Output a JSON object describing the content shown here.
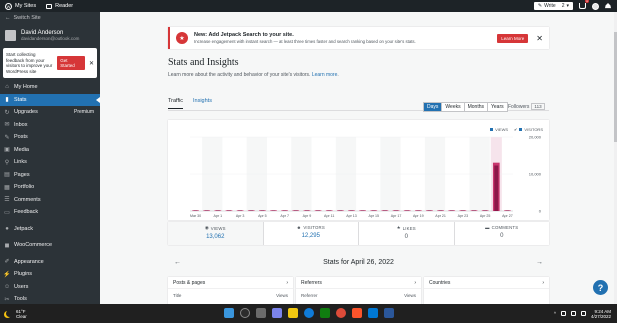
{
  "topbar": {
    "my_sites": "My Sites",
    "reader": "Reader",
    "write": "Write",
    "write_count": "2",
    "cart_badge": "1"
  },
  "sidebar": {
    "switch_site": "Switch Site",
    "site_name": "David Anderson",
    "site_url": "davidanderson@outlook.com",
    "feedback": {
      "text": "Start collecting feedback from your visitors to improve your WordPress site",
      "button": "Get Started"
    },
    "items": [
      {
        "label": "My Home",
        "icon": "home-icon",
        "glyph": "⌂"
      },
      {
        "label": "Stats",
        "icon": "stats-icon",
        "glyph": "▮",
        "active": true
      },
      {
        "label": "Upgrades",
        "icon": "upgrades-icon",
        "glyph": "↻",
        "right": "Premium"
      },
      {
        "label": "Inbox",
        "icon": "inbox-icon",
        "glyph": "✉"
      },
      {
        "label": "Posts",
        "icon": "posts-icon",
        "glyph": "✎"
      },
      {
        "label": "Media",
        "icon": "media-icon",
        "glyph": "▣"
      },
      {
        "label": "Links",
        "icon": "links-icon",
        "glyph": "⚲"
      },
      {
        "label": "Pages",
        "icon": "pages-icon",
        "glyph": "▤"
      },
      {
        "label": "Portfolio",
        "icon": "portfolio-icon",
        "glyph": "▦"
      },
      {
        "label": "Comments",
        "icon": "comments-icon",
        "glyph": "☰"
      },
      {
        "label": "Feedback",
        "icon": "feedback-icon",
        "glyph": "▭"
      },
      {
        "label": "Jetpack",
        "icon": "jetpack-icon",
        "glyph": "●"
      },
      {
        "label": "WooCommerce",
        "icon": "woocommerce-icon",
        "glyph": "◼"
      },
      {
        "label": "Appearance",
        "icon": "appearance-icon",
        "glyph": "✐"
      },
      {
        "label": "Plugins",
        "icon": "plugins-icon",
        "glyph": "⚡"
      },
      {
        "label": "Users",
        "icon": "users-icon",
        "glyph": "☺"
      },
      {
        "label": "Tools",
        "icon": "tools-icon",
        "glyph": "✂"
      }
    ]
  },
  "banner": {
    "title": "New: Add Jetpack Search to your site.",
    "description": "Increase engagement with instant search — at least three times faster and search ranking based on your site's stats.",
    "button": "Learn More"
  },
  "page": {
    "title": "Stats and Insights",
    "subtitle": "Learn more about the activity and behavior of your site's visitors.",
    "subtitle_link": "Learn more"
  },
  "tabs": {
    "traffic": "Traffic",
    "insights": "Insights"
  },
  "periods": [
    "Days",
    "Weeks",
    "Months",
    "Years"
  ],
  "active_period": "Days",
  "followers": {
    "label": "Followers",
    "count": "113"
  },
  "chart_data": {
    "type": "bar",
    "legend": [
      "VIEWS",
      "VISITORS"
    ],
    "categories": [
      "Mar 30",
      "Apr 1",
      "Apr 3",
      "Apr 5",
      "Apr 7",
      "Apr 9",
      "Apr 11",
      "Apr 13",
      "Apr 15",
      "Apr 17",
      "Apr 19",
      "Apr 21",
      "Apr 23",
      "Apr 25",
      "Apr 27"
    ],
    "y_ticks": [
      "0",
      "10,000",
      "20,000"
    ],
    "ylim": [
      0,
      20000
    ],
    "series": [
      {
        "name": "VIEWS",
        "values": [
          0,
          0,
          0,
          0,
          0,
          0,
          0,
          0,
          0,
          0,
          0,
          0,
          0,
          0,
          0,
          0,
          0,
          0,
          0,
          0,
          0,
          0,
          0,
          0,
          0,
          0,
          0,
          13062,
          0
        ]
      },
      {
        "name": "VISITORS",
        "values": [
          0,
          0,
          0,
          0,
          0,
          0,
          0,
          0,
          0,
          0,
          0,
          0,
          0,
          0,
          0,
          0,
          0,
          0,
          0,
          0,
          0,
          0,
          0,
          0,
          0,
          0,
          0,
          12295,
          0
        ]
      }
    ],
    "colors": {
      "views": "#c9356e",
      "visitors": "#8c1749",
      "highlight": "#f6e4ec",
      "bar_bg": "#f6f7f7"
    }
  },
  "stats": [
    {
      "label": "VIEWS",
      "value": "13,062",
      "icon": "eye-icon",
      "glyph": "◉"
    },
    {
      "label": "VISITORS",
      "value": "12,295",
      "icon": "person-icon",
      "glyph": "☻"
    },
    {
      "label": "LIKES",
      "value": "0",
      "icon": "star-icon",
      "glyph": "★"
    },
    {
      "label": "COMMENTS",
      "value": "0",
      "icon": "comment-icon",
      "glyph": "▬"
    }
  ],
  "stats_for": "Stats for April 26, 2022",
  "panels": [
    {
      "title": "Posts & pages",
      "col_left": "Title",
      "col_right": "Views"
    },
    {
      "title": "Referrers",
      "col_left": "Referrer",
      "col_right": "Views"
    },
    {
      "title": "Countries",
      "col_left": "",
      "col_right": ""
    }
  ],
  "help": "?",
  "taskbar": {
    "temp": "61°F",
    "condition": "Clear",
    "time": "9:24 AM",
    "date": "4/27/2022"
  }
}
